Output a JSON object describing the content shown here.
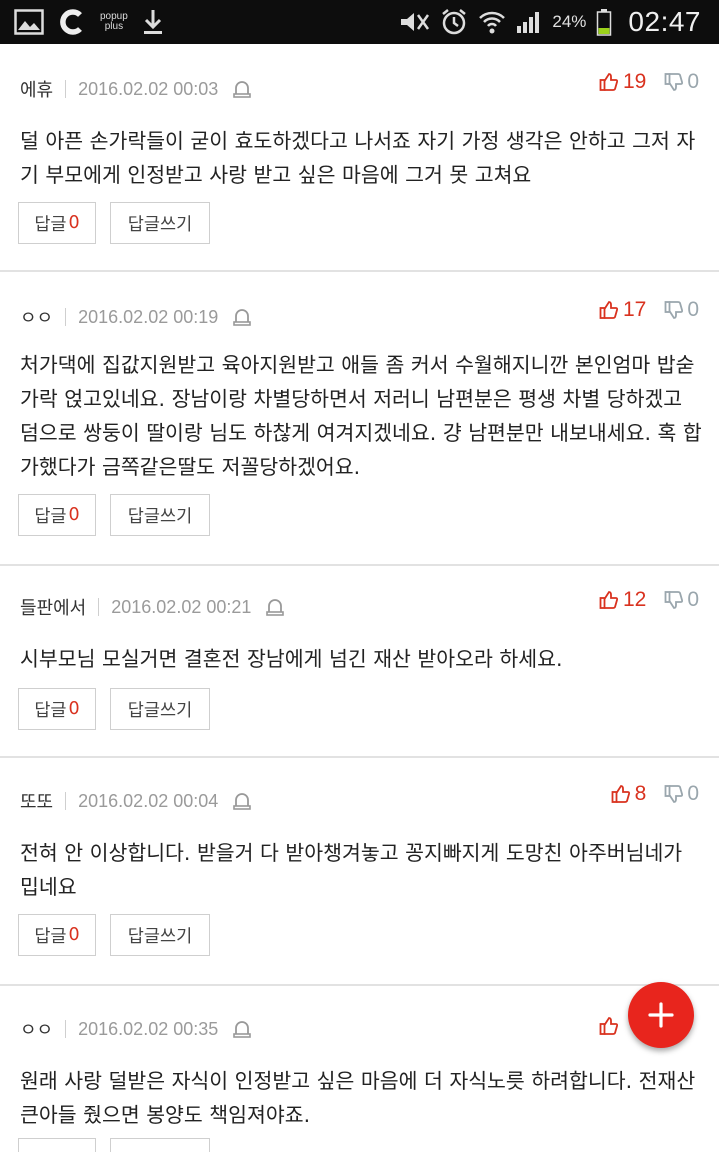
{
  "statusbar": {
    "popup_line1": "popup",
    "popup_line2": "plus",
    "battery": "24%",
    "time": "02:47"
  },
  "labels": {
    "reply": "답글",
    "write": "답글쓰기"
  },
  "comments": [
    {
      "name": "에휴",
      "date": "2016.02.02 00:03",
      "up": "19",
      "down": "0",
      "body": "덜 아픈 손가락들이 굳이 효도하겠다고 나서죠 자기 가정 생각은 안하고 그저 자기 부모에게 인정받고 사랑 받고 싶은 마음에 그거 못 고쳐요",
      "replies": "0"
    },
    {
      "name": "ㅇㅇ",
      "date": "2016.02.02 00:19",
      "up": "17",
      "down": "0",
      "body": "처가댁에 집값지원받고 육아지원받고 애들 좀 커서 수월해지니깐 본인엄마 밥숟가락 얹고있네요. 장남이랑 차별당하면서 저러니 남편분은 평생 차별 당하겠고 덤으로 쌍둥이 딸이랑 님도 하찮게 여겨지겠네요. 걍 남편분만 내보내세요. 혹 합가했다가 금쪽같은딸도 저꼴당하겠어요.",
      "replies": "0"
    },
    {
      "name": "들판에서",
      "date": "2016.02.02 00:21",
      "up": "12",
      "down": "0",
      "body": "시부모님 모실거면 결혼전 장남에게 넘긴 재산 받아오라 하세요.",
      "replies": "0"
    },
    {
      "name": "또또",
      "date": "2016.02.02 00:04",
      "up": "8",
      "down": "0",
      "body": "전혀 안 이상합니다. 받을거 다 받아챙겨놓고 꽁지빠지게 도망친 아주버님네가 밉네요",
      "replies": "0"
    },
    {
      "name": "ㅇㅇ",
      "date": "2016.02.02 00:35",
      "up": "",
      "down": "",
      "body": "원래 사랑 덜받은 자식이 인정받고 싶은 마음에 더 자식노릇 하려합니다. 전재산 큰아들 줬으면 봉양도 책임져야죠.",
      "replies": ""
    }
  ]
}
